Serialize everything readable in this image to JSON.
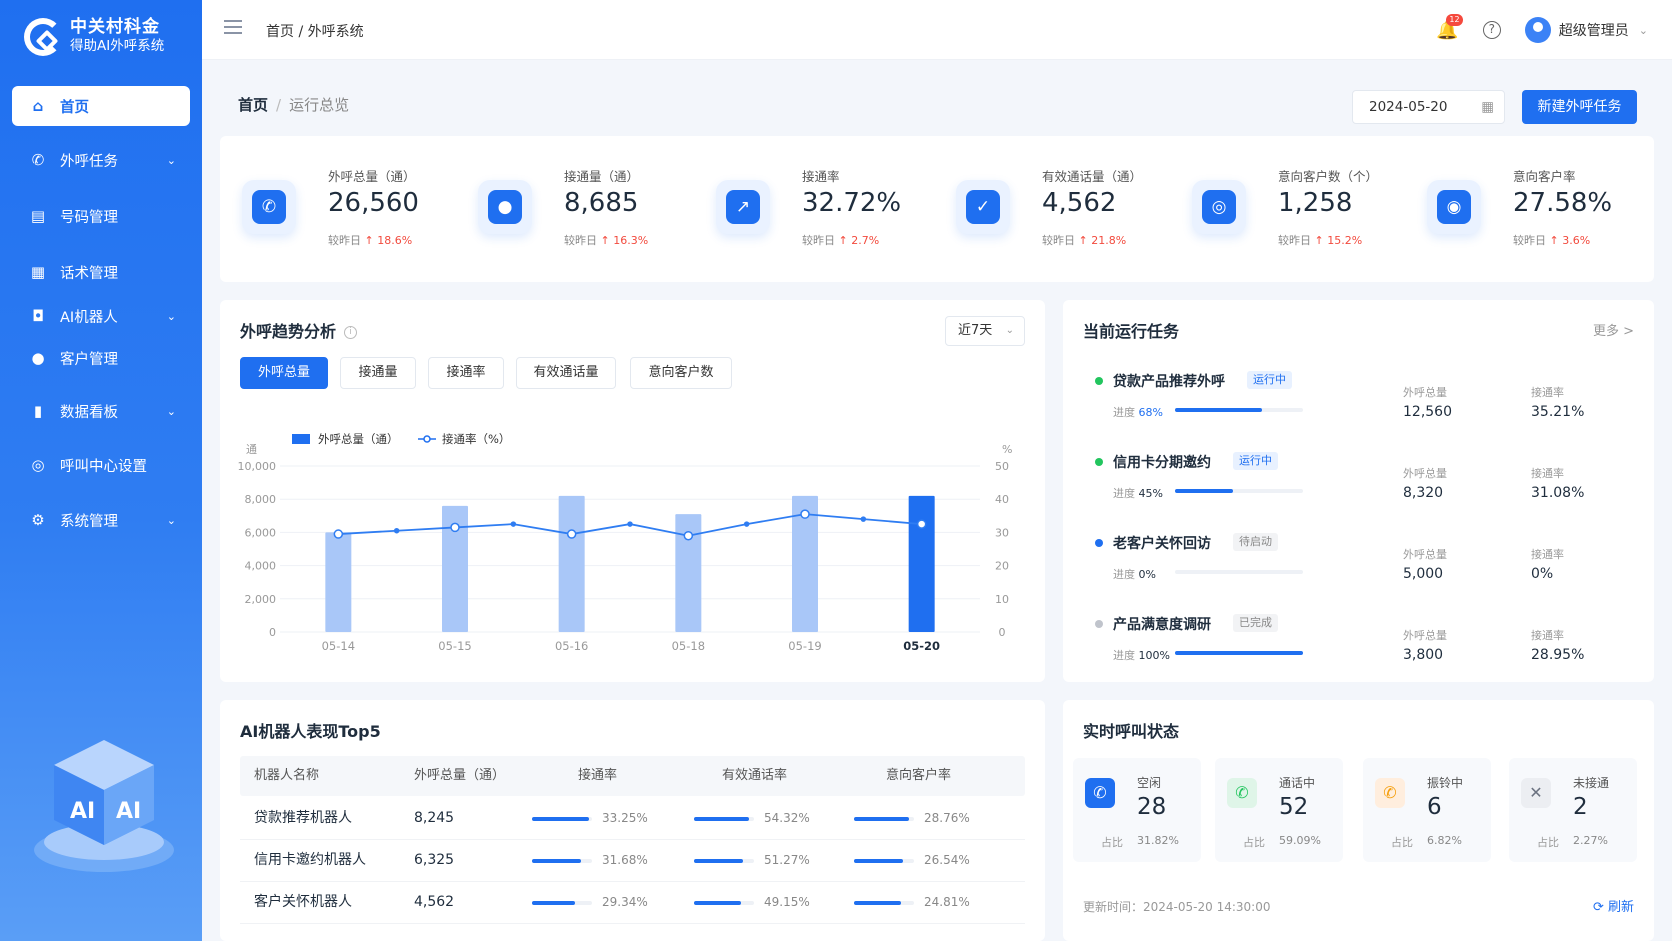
{
  "app": {
    "name_line1": "中关村科金",
    "name_line2": "得助AI外呼系统"
  },
  "nav": {
    "items": [
      {
        "label": "首页",
        "icon": "home-icon",
        "active": true,
        "chevron": false
      },
      {
        "label": "外呼任务",
        "icon": "phone-icon",
        "chevron": true
      },
      {
        "label": "号码管理",
        "icon": "number-icon",
        "chevron": false
      },
      {
        "label": "话术管理",
        "icon": "script-icon",
        "chevron": false
      },
      {
        "label": "AI机器人",
        "icon": "robot-icon",
        "chevron": true
      },
      {
        "label": "客户管理",
        "icon": "user-icon",
        "chevron": false
      },
      {
        "label": "数据看板",
        "icon": "chart-icon",
        "chevron": true
      },
      {
        "label": "呼叫中心设置",
        "icon": "settings-icon",
        "chevron": false
      },
      {
        "label": "系统管理",
        "icon": "gear-icon",
        "chevron": true
      }
    ]
  },
  "topbar": {
    "breadcrumb": "首页 / 外呼系统",
    "notification_count": "12",
    "user_name": "超级管理员"
  },
  "page": {
    "title": "首页",
    "subtitle": "运行总览",
    "date": "2024-05-20",
    "new_task_label": "新建外呼任务"
  },
  "stats": [
    {
      "label": "外呼总量（通）",
      "value": "26,560",
      "cmp_label": "较昨日",
      "cmp_value": "↑ 18.6%",
      "icon": "phone-icon"
    },
    {
      "label": "接通量（通）",
      "value": "8,685",
      "cmp_label": "较昨日",
      "cmp_value": "↑ 16.3%",
      "icon": "user-icon"
    },
    {
      "label": "接通率",
      "value": "32.72%",
      "cmp_label": "较昨日",
      "cmp_value": "↑ 2.7%",
      "icon": "trend-icon"
    },
    {
      "label": "有效通话量（通）",
      "value": "4,562",
      "cmp_label": "较昨日",
      "cmp_value": "↑ 21.8%",
      "icon": "shield-check-icon"
    },
    {
      "label": "意向客户数（个）",
      "value": "1,258",
      "cmp_label": "较昨日",
      "cmp_value": "↑ 15.2%",
      "icon": "target-icon"
    },
    {
      "label": "意向客户率",
      "value": "27.58%",
      "cmp_label": "较昨日",
      "cmp_value": "↑ 3.6%",
      "icon": "target-icon"
    }
  ],
  "trend": {
    "title": "外呼趋势分析",
    "range": "近7天",
    "tabs": [
      "外呼总量",
      "接通量",
      "接通率",
      "有效通话量",
      "意向客户数"
    ],
    "active_tab": 0
  },
  "chart_data": {
    "type": "bar",
    "categories": [
      "05-14",
      "05-15",
      "05-16",
      "05-18",
      "05-19",
      "05-20"
    ],
    "y_left_unit": "通",
    "y_right_unit": "%",
    "y_left_ticks": [
      "10,000",
      "8,000",
      "6,000",
      "4,000",
      "2,000",
      "0"
    ],
    "y_right_ticks": [
      "50",
      "40",
      "30",
      "20",
      "10",
      "0"
    ],
    "ylim_left": [
      0,
      10000
    ],
    "ylim_right": [
      0,
      50
    ],
    "highlight_index": 5,
    "bar_color": "#a9c7f8",
    "highlight_color": "#1f6ff0",
    "line_color": "#2f7df2",
    "series": [
      {
        "name": "外呼总量（通）",
        "type": "bar",
        "values": [
          6000,
          7600,
          8200,
          7100,
          8200,
          8200
        ]
      },
      {
        "name": "接通率（%）",
        "type": "line",
        "x": [
          0,
          0.5,
          1,
          1.5,
          2,
          2.5,
          3,
          3.5,
          4,
          4.5,
          5
        ],
        "values": [
          29.5,
          30.5,
          31.5,
          32.5,
          29.5,
          32.5,
          29,
          32.5,
          35.5,
          34,
          32.5
        ]
      }
    ]
  },
  "tasks": {
    "title": "当前运行任务",
    "more": "更多 >",
    "progress_label": "进度",
    "total_label": "外呼总量",
    "rate_label": "接通率",
    "items": [
      {
        "name": "贷款产品推荐外呼",
        "status": "运行中",
        "status_kind": "running",
        "dot": "#22c55e",
        "progress": "68%",
        "progress_frac": 0.68,
        "total": "12,560",
        "rate": "35.21%"
      },
      {
        "name": "信用卡分期邀约",
        "status": "运行中",
        "status_kind": "running",
        "dot": "#22c55e",
        "progress": "45%",
        "progress_frac": 0.45,
        "total": "8,320",
        "rate": "31.08%"
      },
      {
        "name": "老客户关怀回访",
        "status": "待启动",
        "status_kind": "pending",
        "dot": "#1f6ff0",
        "progress": "0%",
        "progress_frac": 0,
        "total": "5,000",
        "rate": "0%"
      },
      {
        "name": "产品满意度调研",
        "status": "已完成",
        "status_kind": "done",
        "dot": "#c0c4cc",
        "progress": "100%",
        "progress_frac": 1,
        "total": "3,800",
        "rate": "28.95%"
      }
    ]
  },
  "robots": {
    "title": "AI机器人表现Top5",
    "headers": [
      "机器人名称",
      "外呼总量（通）",
      "接通率",
      "有效通话率",
      "意向客户率"
    ],
    "rows": [
      {
        "name": "贷款推荐机器人",
        "total": "8,245",
        "rate": "33.25%",
        "rate_f": 0.95,
        "effective": "54.32%",
        "effective_f": 0.92,
        "intent": "28.76%",
        "intent_f": 0.92
      },
      {
        "name": "信用卡邀约机器人",
        "total": "6,325",
        "rate": "31.68%",
        "rate_f": 0.82,
        "effective": "51.27%",
        "effective_f": 0.82,
        "intent": "26.54%",
        "intent_f": 0.82
      },
      {
        "name": "客户关怀机器人",
        "total": "4,562",
        "rate": "29.34%",
        "rate_f": 0.72,
        "effective": "49.15%",
        "effective_f": 0.78,
        "intent": "24.81%",
        "intent_f": 0.78
      }
    ]
  },
  "call_status": {
    "title": "实时呼叫状态",
    "ratio_label": "占比",
    "items": [
      {
        "label": "空闲",
        "value": "28",
        "ratio": "31.82%",
        "icon": "phone-icon",
        "bg": "#1f6ff0",
        "fg": "#fff"
      },
      {
        "label": "通话中",
        "value": "52",
        "ratio": "59.09%",
        "icon": "phone-call-icon",
        "bg": "#dff5e8",
        "fg": "#22c55e"
      },
      {
        "label": "振铃中",
        "value": "6",
        "ratio": "6.82%",
        "icon": "phone-ring-icon",
        "bg": "#ffeede",
        "fg": "#f59e0b"
      },
      {
        "label": "未接通",
        "value": "2",
        "ratio": "2.27%",
        "icon": "phone-missed-icon",
        "bg": "#eceef2",
        "fg": "#6b7280"
      }
    ],
    "update_label": "更新时间：",
    "update_time": "2024-05-20 14:30:00",
    "refresh": "刷新"
  }
}
